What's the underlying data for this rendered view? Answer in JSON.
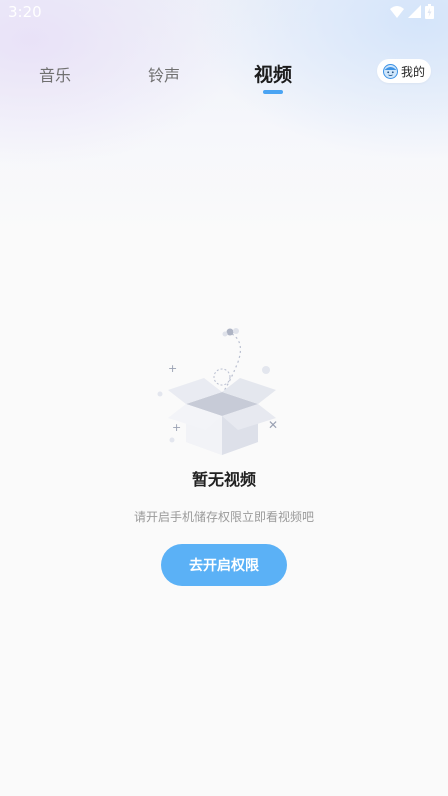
{
  "status_bar": {
    "time": "3:20",
    "icons": [
      "wifi-icon",
      "signal-icon",
      "battery-icon"
    ]
  },
  "tabs": [
    {
      "label": "音乐",
      "active": false
    },
    {
      "label": "铃声",
      "active": false
    },
    {
      "label": "视频",
      "active": true
    }
  ],
  "mine_button": {
    "label": "我的",
    "icon": "avatar-icon"
  },
  "empty_state": {
    "icon": "empty-box-icon",
    "title": "暂无视频",
    "hint": "请开启手机储存权限立即看视频吧",
    "button_label": "去开启权限"
  },
  "colors": {
    "accent": "#5bb1f6",
    "tab_indicator": "#4aa4f3",
    "active_tab_text": "#1c1c1c",
    "inactive_tab_text": "#707070",
    "hint_text": "#9a9a9a"
  }
}
